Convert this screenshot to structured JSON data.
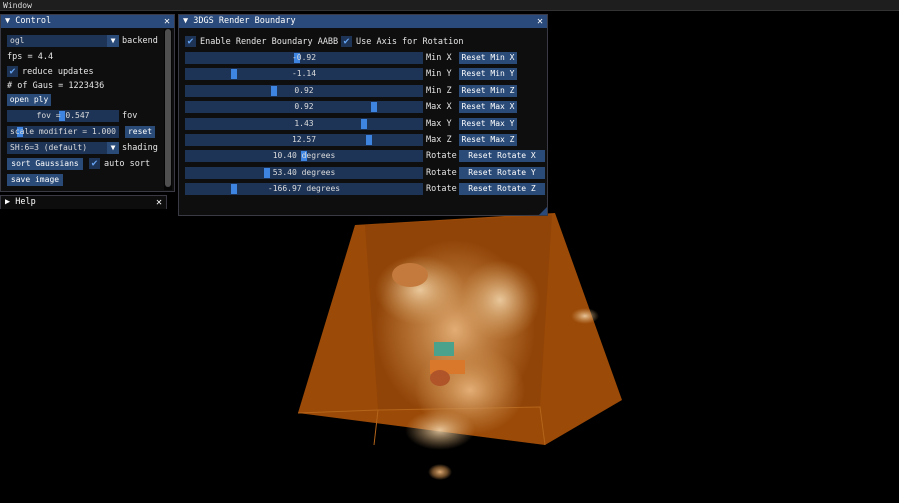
{
  "os_window_title": "Window",
  "control": {
    "title": "Control",
    "backend_value": "ogl",
    "backend_label": "backend",
    "fps_text": "fps = 4.4",
    "reduce_updates_label": "reduce updates",
    "gaussians_text": "# of Gaus = 1223436",
    "open_ply_label": "open ply",
    "fov_value": "fov = 0.547",
    "fov_label": "fov",
    "scale_value": "scale modifier = 1.000",
    "reset_label": "reset",
    "shading_value": "SH:6=3 (default)",
    "shading_label": "shading",
    "sort_label": "sort Gaussians",
    "auto_sort_label": "auto sort",
    "save_image_label": "save image"
  },
  "help": {
    "title": "Help"
  },
  "boundary": {
    "title": "3DGS Render Boundary",
    "enable_label": "Enable Render Boundary AABB",
    "use_axis_label": "Use Axis for Rotation",
    "sliders": [
      {
        "value": "-0.92",
        "label": "Min X",
        "reset": "Reset Min X",
        "pos": 0.47
      },
      {
        "value": "-1.14",
        "label": "Min Y",
        "reset": "Reset Min Y",
        "pos": 0.2
      },
      {
        "value": "0.92",
        "label": "Min Z",
        "reset": "Reset Min Z",
        "pos": 0.37
      },
      {
        "value": "0.92",
        "label": "Max X",
        "reset": "Reset Max X",
        "pos": 0.8
      },
      {
        "value": "1.43",
        "label": "Max Y",
        "reset": "Reset Max Y",
        "pos": 0.76
      },
      {
        "value": "12.57",
        "label": "Max Z",
        "reset": "Reset Max Z",
        "pos": 0.78
      },
      {
        "value": "10.40 degrees",
        "label": "Rotate X",
        "reset": "Reset Rotate X",
        "pos": 0.5
      },
      {
        "value": "53.40 degrees",
        "label": "Rotate Y",
        "reset": "Reset Rotate Y",
        "pos": 0.34
      },
      {
        "value": "-166.97 degrees",
        "label": "Rotate Z",
        "reset": "Reset Rotate Z",
        "pos": 0.2
      }
    ]
  },
  "colors": {
    "title_active": "#294a7a",
    "button": "#2a4b78",
    "frame": "#1d3457",
    "grab": "#3d85e0",
    "box_fill": "#9b4a08"
  }
}
